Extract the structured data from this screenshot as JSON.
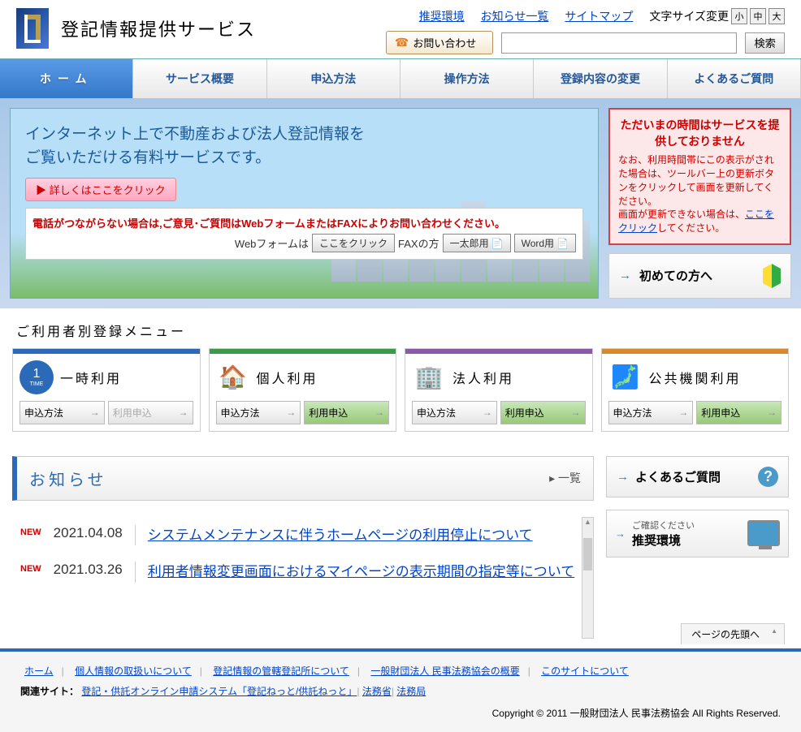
{
  "site_title": "登記情報提供サービス",
  "top_links": {
    "env": "推奨環境",
    "news": "お知らせ一覧",
    "sitemap": "サイトマップ"
  },
  "font_size": {
    "label": "文字サイズ変更",
    "s": "小",
    "m": "中",
    "l": "大"
  },
  "contact_btn": "お問い合わせ",
  "search_btn": "検索",
  "nav": {
    "home": "ホーム",
    "overview": "サービス概要",
    "apply": "申込方法",
    "howto": "操作方法",
    "change": "登録内容の変更",
    "faq": "よくあるご質問"
  },
  "hero": {
    "line1": "インターネット上で不動産および法人登記情報を",
    "line2": "ご覧いただける有料サービスです。",
    "detail_btn": "▶ 詳しくはここをクリック",
    "contact_msg": "電話がつながらない場合は,ご意見･ご質問はWebフォームまたはFAXによりお問い合わせください。",
    "webform_label": "Webフォームは",
    "webform_btn": "ここをクリック",
    "fax_label": "FAXの方",
    "ichitaro": "一太郎用",
    "word": "Word用"
  },
  "alert": {
    "title": "ただいまの時間はサービスを提供しておりません",
    "body1": "なお、利用時間帯にこの表示がされた場合は、ツールバー上の更新ボタンをクリックして画面を更新してください。",
    "body2_a": "画面が更新できない場合は、",
    "body2_link": "ここをクリック",
    "body2_b": "してください。"
  },
  "first_time": "初めての方へ",
  "user_menu_title": "ご利用者別登録メニュー",
  "cards": {
    "temp": "一時利用",
    "personal": "個人利用",
    "corp": "法人利用",
    "public": "公共機関利用",
    "apply_btn": "申込方法",
    "use_btn": "利用申込"
  },
  "news": {
    "title": "お知らせ",
    "list_link": "一覧",
    "new": "NEW",
    "items": [
      {
        "date": "2021.04.08",
        "text": "システムメンテナンスに伴うホームページの利用停止について"
      },
      {
        "date": "2021.03.26",
        "text": "利用者情報変更画面におけるマイページの表示期間の指定等について"
      }
    ]
  },
  "side": {
    "faq": "よくあるご質問",
    "env_small": "ご確認ください",
    "env_big": "推奨環境"
  },
  "page_top": "ページの先頭へ",
  "footer": {
    "links": {
      "home": "ホーム",
      "privacy": "個人情報の取扱いについて",
      "jurisdiction": "登記情報の管轄登記所について",
      "org": "一般財団法人 民事法務協会の概要",
      "about": "このサイトについて"
    },
    "related_label": "関連サイト：",
    "related": {
      "touki": "登記・供託オンライン申請システム「登記ねっと/供託ねっと」",
      "moj": "法務省",
      "houmukyoku": "法務局"
    },
    "copyright": "Copyright © 2011 一般財団法人 民事法務協会 All Rights Reserved."
  }
}
